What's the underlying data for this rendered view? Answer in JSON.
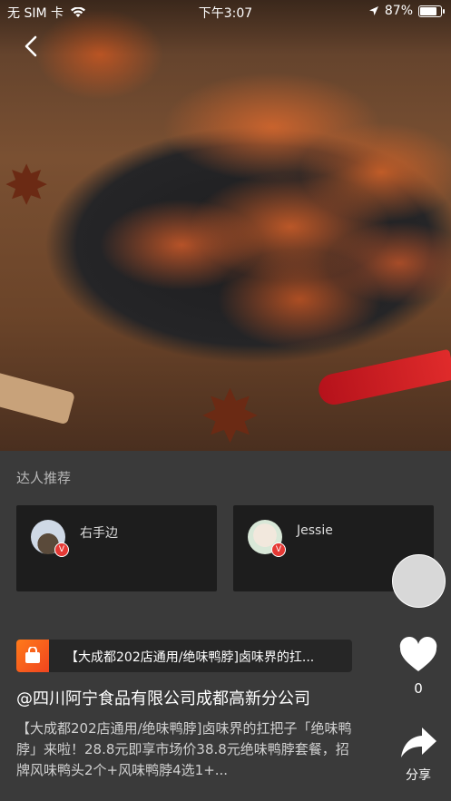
{
  "status_bar": {
    "carrier": "无 SIM 卡",
    "time": "下午3:07",
    "battery": "87%"
  },
  "section": {
    "title": "达人推荐"
  },
  "influencers": [
    {
      "name": "右手边"
    },
    {
      "name": "Jessie"
    }
  ],
  "promo": {
    "text": "【大成都202店通用/绝味鸭脖]卤味界的扛..."
  },
  "post": {
    "company": "@四川阿宁食品有限公司成都高新分公司",
    "description": "【大成都202店通用/绝味鸭脖]卤味界的扛把子「绝味鸭脖」来啦！28.8元即享市场价38.8元绝味鸭脖套餐，招牌风味鸭头2个+风味鸭脖4选1+..."
  },
  "actions": {
    "like_count": "0",
    "share_label": "分享"
  },
  "colors": {
    "background": "#3a3a3a",
    "card": "#1d1d1d",
    "badge": "#e53935",
    "promo_icon": "#f0451f"
  }
}
